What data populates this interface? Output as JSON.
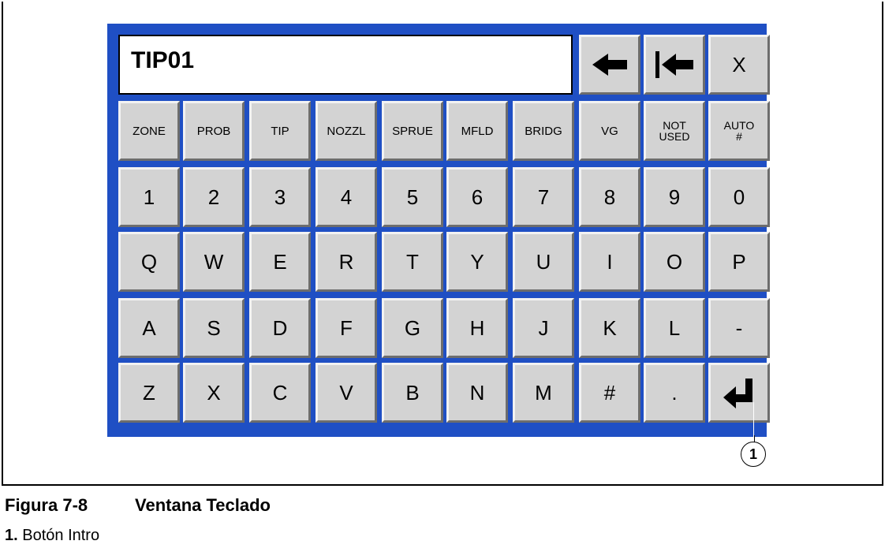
{
  "keypad": {
    "display_value": "TIP01",
    "top_keys": {
      "backspace_icon": "arrow-left-icon",
      "clear_icon": "bar-arrow-left-icon",
      "close_label": "X"
    },
    "row_categories": [
      "ZONE",
      "PROB",
      "TIP",
      "NOZZL",
      "SPRUE",
      "MFLD",
      "BRIDG",
      "VG",
      "NOT\nUSED",
      "AUTO\n#"
    ],
    "row_numbers": [
      "1",
      "2",
      "3",
      "4",
      "5",
      "6",
      "7",
      "8",
      "9",
      "0"
    ],
    "row_q": [
      "Q",
      "W",
      "E",
      "R",
      "T",
      "Y",
      "U",
      "I",
      "O",
      "P"
    ],
    "row_a": [
      "A",
      "S",
      "D",
      "F",
      "G",
      "H",
      "J",
      "K",
      "L",
      "-"
    ],
    "row_z": [
      "Z",
      "X",
      "C",
      "V",
      "B",
      "N",
      "M",
      "#",
      "."
    ],
    "enter_icon": "enter-icon",
    "colors": {
      "panel": "#1f4fc4",
      "key": "#d3d3d3"
    }
  },
  "callout": {
    "label": "1"
  },
  "caption": {
    "figure_number": "Figura 7-8",
    "figure_title": "Ventana Teclado"
  },
  "legend": {
    "number": "1.",
    "text": "Botón Intro"
  }
}
